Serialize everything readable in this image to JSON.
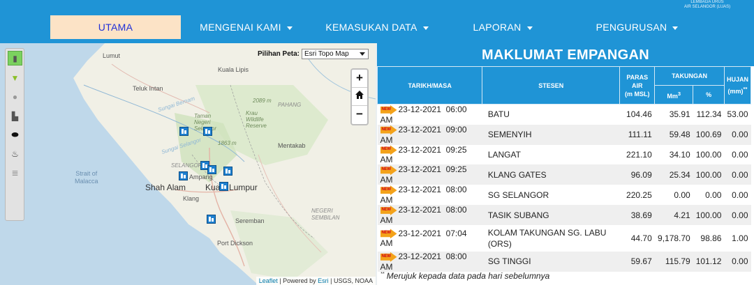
{
  "org": {
    "line1": "LEMBAGA URUS",
    "line2": "AIR SELANGOR (LUAS)"
  },
  "nav": [
    {
      "label": "UTAMA",
      "dropdown": false,
      "active": true
    },
    {
      "label": "MENGENAI KAMI",
      "dropdown": true
    },
    {
      "label": "KEMASUKAN DATA",
      "dropdown": true
    },
    {
      "label": "LAPORAN",
      "dropdown": true
    },
    {
      "label": "PENGURUSAN",
      "dropdown": true
    }
  ],
  "map": {
    "basemap_label": "Pilihan Peta:",
    "basemap_value": "Esri Topo Map",
    "zoom_in": "+",
    "zoom_out": "−",
    "places": {
      "lumut": "Lumut",
      "kualalipis": "Kuala Lipis",
      "telukintan": "Teluk Intan",
      "pahang": "PAHANG",
      "elev1": "2089 m",
      "krau": "Krau\nWildlife\nReserve",
      "taman": "Taman\nNegeri\nSelangor",
      "elev2": "1863 m",
      "mentakab": "Mentakab",
      "selangor": "SELANGOR",
      "strait": "Strait of\nMalacca",
      "shahalam": "Shah Alam",
      "ampang": "Ampang",
      "kl": "Kuala Lumpur",
      "klang": "Klang",
      "seremban": "Seremban",
      "portdickson": "Port Dickson",
      "negeri": "NEGERI\nSEMBILAN",
      "river1": "Sungai Bernam",
      "river2": "Sungai Selangor"
    },
    "attribution": {
      "leaflet": "Leaflet",
      "powered": "| Powered by",
      "esri": "Esri",
      "rest": "| USGS, NOAA"
    }
  },
  "panel": {
    "title": "MAKLUMAT EMPANGAN",
    "headers": {
      "date": "TARIKH/MASA",
      "station": "STESEN",
      "level": "PARAS AIR (m MSL)",
      "level_l1": "PARAS",
      "level_l2": "AIR",
      "level_l3": "(m MSL)",
      "storage": "TAKUNGAN",
      "mm3": "Mm",
      "mm3_sup": "3",
      "pct": "%",
      "rain": "HUJAN",
      "rain_unit": "(mm)",
      "rain_sup": "**"
    },
    "new_badge": "NEW",
    "rows": [
      {
        "date": "23-12-2021",
        "time": "06:00 AM",
        "station": "BATU",
        "level": "104.46",
        "mm3": "35.91",
        "pct": "112.34",
        "rain": "53.00"
      },
      {
        "date": "23-12-2021",
        "time": "09:00 AM",
        "station": "SEMENYIH",
        "level": "111.11",
        "mm3": "59.48",
        "pct": "100.69",
        "rain": "0.00"
      },
      {
        "date": "23-12-2021",
        "time": "09:25 AM",
        "station": "LANGAT",
        "level": "221.10",
        "mm3": "34.10",
        "pct": "100.00",
        "rain": "0.00"
      },
      {
        "date": "23-12-2021",
        "time": "09:25 AM",
        "station": "KLANG GATES",
        "level": "96.09",
        "mm3": "25.34",
        "pct": "100.00",
        "rain": "0.00"
      },
      {
        "date": "23-12-2021",
        "time": "08:00 AM",
        "station": "SG SELANGOR",
        "level": "220.25",
        "mm3": "0.00",
        "pct": "0.00",
        "rain": "0.00"
      },
      {
        "date": "23-12-2021",
        "time": "08:00 AM",
        "station": "TASIK SUBANG",
        "level": "38.69",
        "mm3": "4.21",
        "pct": "100.00",
        "rain": "0.00"
      },
      {
        "date": "23-12-2021",
        "time": "07:04 AM",
        "station": "KOLAM TAKUNGAN SG. LABU (ORS)",
        "level": "44.70",
        "mm3": "9,178.70",
        "pct": "98.86",
        "rain": "1.00"
      },
      {
        "date": "23-12-2021",
        "time": "08:00 AM",
        "station": "SG TINGGI",
        "level": "59.67",
        "mm3": "115.79",
        "pct": "101.12",
        "rain": "0.00"
      }
    ],
    "note_mark": "**",
    "note": "Merujuk kepada data pada hari sebelumnya"
  },
  "colors": {
    "header_blue": "#1f94d6",
    "active_tab": "#fce3c6",
    "active_text": "#1f2fd8",
    "badge": "#f3a21a"
  }
}
